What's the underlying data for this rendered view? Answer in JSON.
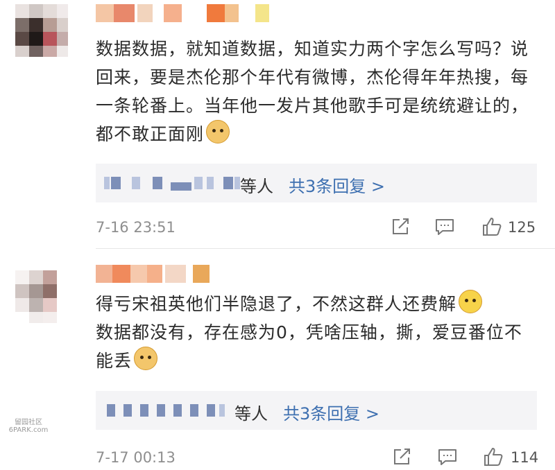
{
  "comments": [
    {
      "text": "数据数据，就知道数据，知道实力两个字怎么写吗？说回来，要是杰伦那个年代有微博，杰伦得年年热搜，每一条轮番上。当年他一发片其他歌手可是统统避让的，都不敢正面刚",
      "emoji": "doge-emoji",
      "reply": {
        "suffix": "等人",
        "more": "共3条回复 >"
      },
      "time": "7-16 23:51",
      "likes": "125"
    },
    {
      "text": "得亏宋祖英他们半隐退了，不然这群人还费解",
      "text2": "数据都没有，存在感为0，凭啥压轴，撕，爱豆番位不能丢",
      "emoji_mid": "laughing-emoji",
      "emoji": "doge-emoji",
      "reply": {
        "suffix": "等人",
        "more": "共3条回复 >"
      },
      "time": "7-17 00:13",
      "likes": "114"
    }
  ],
  "watermark": {
    "line1": "留园社区",
    "line2": "6PARK.com"
  },
  "colors": {
    "link": "#3d6fb0",
    "meta": "#8e8e8e",
    "reply_bg": "#f4f4f6"
  }
}
